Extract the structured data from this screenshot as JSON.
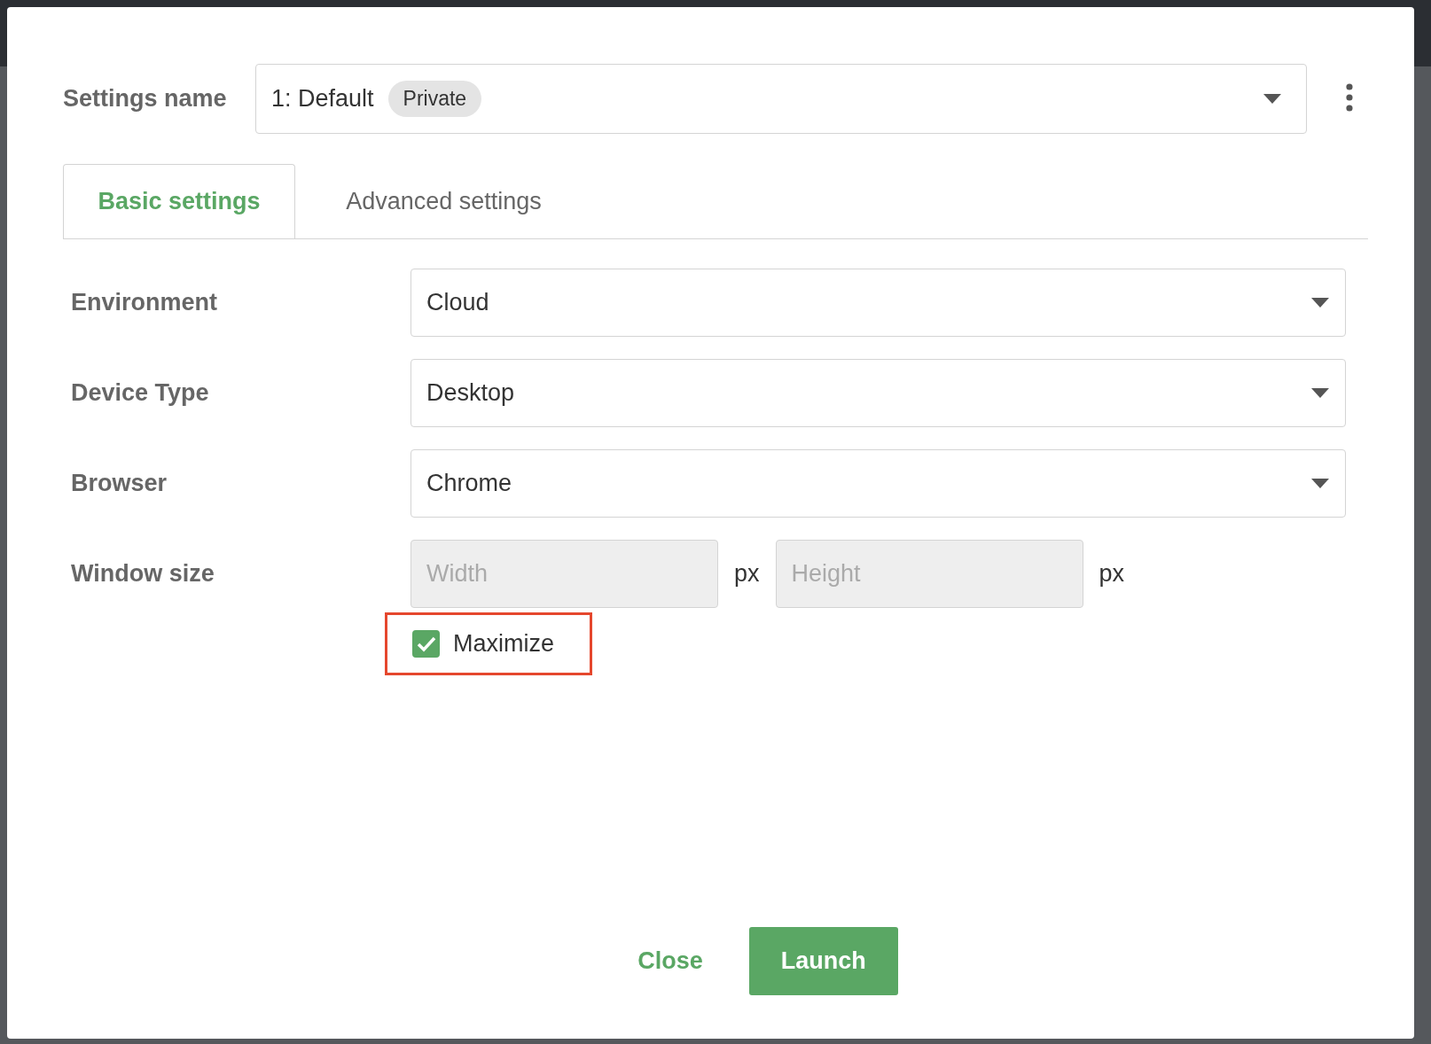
{
  "settings_name": {
    "label": "Settings name",
    "value": "1: Default",
    "badge": "Private"
  },
  "tabs": [
    {
      "label": "Basic settings",
      "selected": true
    },
    {
      "label": "Advanced settings",
      "selected": false
    }
  ],
  "fields": [
    {
      "kind": "select",
      "label": "Environment",
      "value": "Cloud"
    },
    {
      "kind": "select",
      "label": "Device Type",
      "value": "Desktop"
    },
    {
      "kind": "select",
      "label": "Browser",
      "value": "Chrome"
    },
    {
      "kind": "size",
      "label": "Window size",
      "disabled": true,
      "width": {
        "placeholder": "Width",
        "unit": "px"
      },
      "height": {
        "placeholder": "Height",
        "unit": "px"
      }
    }
  ],
  "maximize": {
    "label": "Maximize",
    "checked": true,
    "highlighted": true
  },
  "buttons": [
    {
      "kind": "text",
      "label": "Close"
    },
    {
      "kind": "primary",
      "label": "Launch"
    }
  ]
}
